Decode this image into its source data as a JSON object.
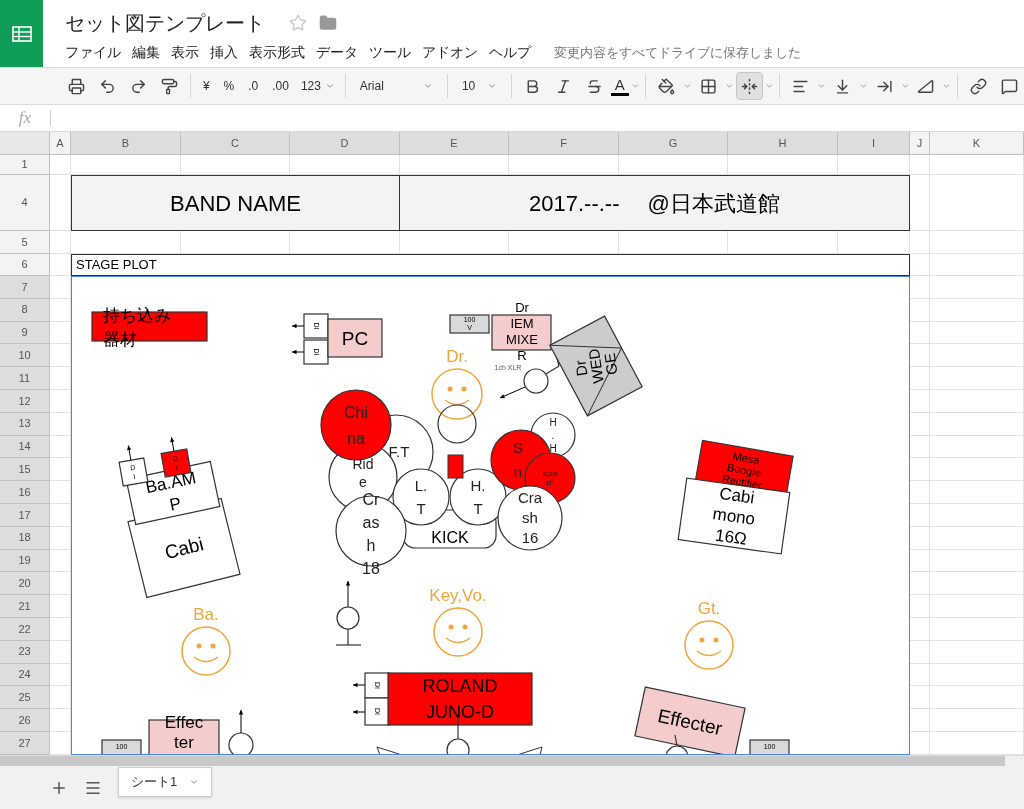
{
  "app": {
    "title": "セット図テンプレート",
    "menus": [
      "ファイル",
      "編集",
      "表示",
      "挿入",
      "表示形式",
      "データ",
      "ツール",
      "アドオン",
      "ヘルプ"
    ],
    "save_status": "変更内容をすべてドライブに保存しました"
  },
  "toolbar": {
    "currency": "¥",
    "percent": "%",
    "decrease_decimals": ".0",
    "increase_decimals": ".00",
    "number_format": "123",
    "font": "Arial",
    "font_size": "10",
    "text_color": "A"
  },
  "formula_bar": {
    "label": "fx"
  },
  "columns": [
    {
      "label": "A",
      "selected": false
    },
    {
      "label": "B",
      "selected": true
    },
    {
      "label": "C",
      "selected": true
    },
    {
      "label": "D",
      "selected": true
    },
    {
      "label": "E",
      "selected": true
    },
    {
      "label": "F",
      "selected": true
    },
    {
      "label": "G",
      "selected": true
    },
    {
      "label": "H",
      "selected": true
    },
    {
      "label": "I",
      "selected": true
    },
    {
      "label": "J",
      "selected": false
    },
    {
      "label": "K",
      "selected": false
    }
  ],
  "rows": [
    {
      "label": "1",
      "selected": false
    },
    {
      "label": "4",
      "selected": false
    },
    {
      "label": "5",
      "selected": false
    },
    {
      "label": "6",
      "selected": false
    },
    {
      "label": "7",
      "selected": true
    },
    {
      "label": "8",
      "selected": true
    },
    {
      "label": "9",
      "selected": true
    },
    {
      "label": "10",
      "selected": true
    },
    {
      "label": "11",
      "selected": true
    },
    {
      "label": "12",
      "selected": true
    },
    {
      "label": "13",
      "selected": true
    },
    {
      "label": "14",
      "selected": true
    },
    {
      "label": "15",
      "selected": true
    },
    {
      "label": "16",
      "selected": true
    },
    {
      "label": "17",
      "selected": true
    },
    {
      "label": "18",
      "selected": true
    },
    {
      "label": "19",
      "selected": true
    },
    {
      "label": "20",
      "selected": true
    },
    {
      "label": "21",
      "selected": true
    },
    {
      "label": "22",
      "selected": true
    },
    {
      "label": "23",
      "selected": true
    },
    {
      "label": "24",
      "selected": true
    },
    {
      "label": "25",
      "selected": true
    },
    {
      "label": "26",
      "selected": true
    },
    {
      "label": "27",
      "selected": true
    }
  ],
  "header_cells": [
    "BAND NAME",
    "2017.--.--　 @日本武道館"
  ],
  "stage_plot": {
    "label": "STAGE PLOT",
    "items": [
      {
        "kind": "box",
        "color": "#ff0000",
        "lines": [
          "持ち込み",
          "器材"
        ]
      },
      {
        "kind": "di",
        "color": "#ffffff",
        "lines": [
          "DI"
        ]
      },
      {
        "kind": "di",
        "color": "#ffffff",
        "lines": [
          "DI"
        ]
      },
      {
        "kind": "box",
        "color": "#f4cccc",
        "lines": [
          "PC"
        ]
      },
      {
        "kind": "box",
        "color": "#d9d9d9",
        "lines": [
          "100",
          "V"
        ]
      },
      {
        "kind": "box",
        "color": "#f4cccc",
        "lines": [
          "Dr",
          "IEM",
          "MIXE",
          "R"
        ]
      },
      {
        "kind": "text",
        "lines": [
          "1ch XLR"
        ]
      },
      {
        "kind": "mic"
      },
      {
        "kind": "wedge",
        "color": "#cccccc",
        "lines": [
          "Dr",
          "WED",
          "GE"
        ]
      },
      {
        "kind": "face",
        "label": "Dr."
      },
      {
        "kind": "box",
        "color": "#ffffff",
        "lines": [
          "KICK"
        ]
      },
      {
        "kind": "circle",
        "color": "#ffffff",
        "lines": [
          "F.T"
        ]
      },
      {
        "kind": "circle",
        "color": "#ff0000",
        "lines": [
          "Chi",
          "na"
        ]
      },
      {
        "kind": "circle",
        "color": "#ffffff",
        "lines": [
          "Rid",
          "e"
        ]
      },
      {
        "kind": "circle",
        "color": "#ffffff",
        "lines": [
          "Cr",
          "as",
          "h",
          "18"
        ]
      },
      {
        "kind": "circle",
        "color": "#ffffff",
        "lines": [
          "L.",
          "T"
        ]
      },
      {
        "kind": "circle",
        "color": "#ffffff",
        "lines": [
          "H.",
          "T"
        ]
      },
      {
        "kind": "block",
        "color": "#ff0000"
      },
      {
        "kind": "circle",
        "color": "#ffffff",
        "lines": [
          "H",
          ".",
          "H"
        ]
      },
      {
        "kind": "circle",
        "color": "#ff0000",
        "lines": [
          "S",
          "n"
        ]
      },
      {
        "kind": "circle",
        "color": "#ff0000",
        "lines": [
          "spla",
          "sh"
        ]
      },
      {
        "kind": "circle",
        "color": "#ffffff",
        "lines": [
          "Cra",
          "sh",
          "16"
        ]
      },
      {
        "kind": "box",
        "color": "#ffffff",
        "lines": [
          "Cabi"
        ]
      },
      {
        "kind": "box",
        "color": "#ffffff",
        "lines": [
          "Ba.AM",
          "P"
        ]
      },
      {
        "kind": "di",
        "color": "#ffffff",
        "lines": [
          "D",
          "I"
        ]
      },
      {
        "kind": "di",
        "color": "#ff0000",
        "lines": [
          "D",
          "I"
        ]
      },
      {
        "kind": "box",
        "color": "#ff0000",
        "lines": [
          "Mesa",
          "Boogie",
          "Rectifier"
        ]
      },
      {
        "kind": "box",
        "color": "#ffffff",
        "lines": [
          "Cabi",
          "mono",
          "16Ω"
        ]
      },
      {
        "kind": "face",
        "label": "Ba."
      },
      {
        "kind": "face",
        "label": "Key,Vo."
      },
      {
        "kind": "face",
        "label": "Gt."
      },
      {
        "kind": "mic"
      },
      {
        "kind": "di",
        "color": "#ffffff",
        "lines": [
          "DI"
        ]
      },
      {
        "kind": "di",
        "color": "#ffffff",
        "lines": [
          "DI"
        ]
      },
      {
        "kind": "box",
        "color": "#ff0000",
        "lines": [
          "ROLAND",
          "JUNO-D"
        ]
      },
      {
        "kind": "mic"
      },
      {
        "kind": "box",
        "color": "#d9d9d9",
        "lines": [
          "100"
        ]
      },
      {
        "kind": "box",
        "color": "#f4cccc",
        "lines": [
          "Effec",
          "ter"
        ]
      },
      {
        "kind": "mic"
      },
      {
        "kind": "box",
        "color": "#f4cccc",
        "lines": [
          "Effecter"
        ]
      },
      {
        "kind": "box",
        "color": "#d9d9d9",
        "lines": [
          "100"
        ]
      },
      {
        "kind": "mic"
      }
    ]
  },
  "sheet_tabs": [
    {
      "label": "シート1",
      "selected": true
    }
  ]
}
